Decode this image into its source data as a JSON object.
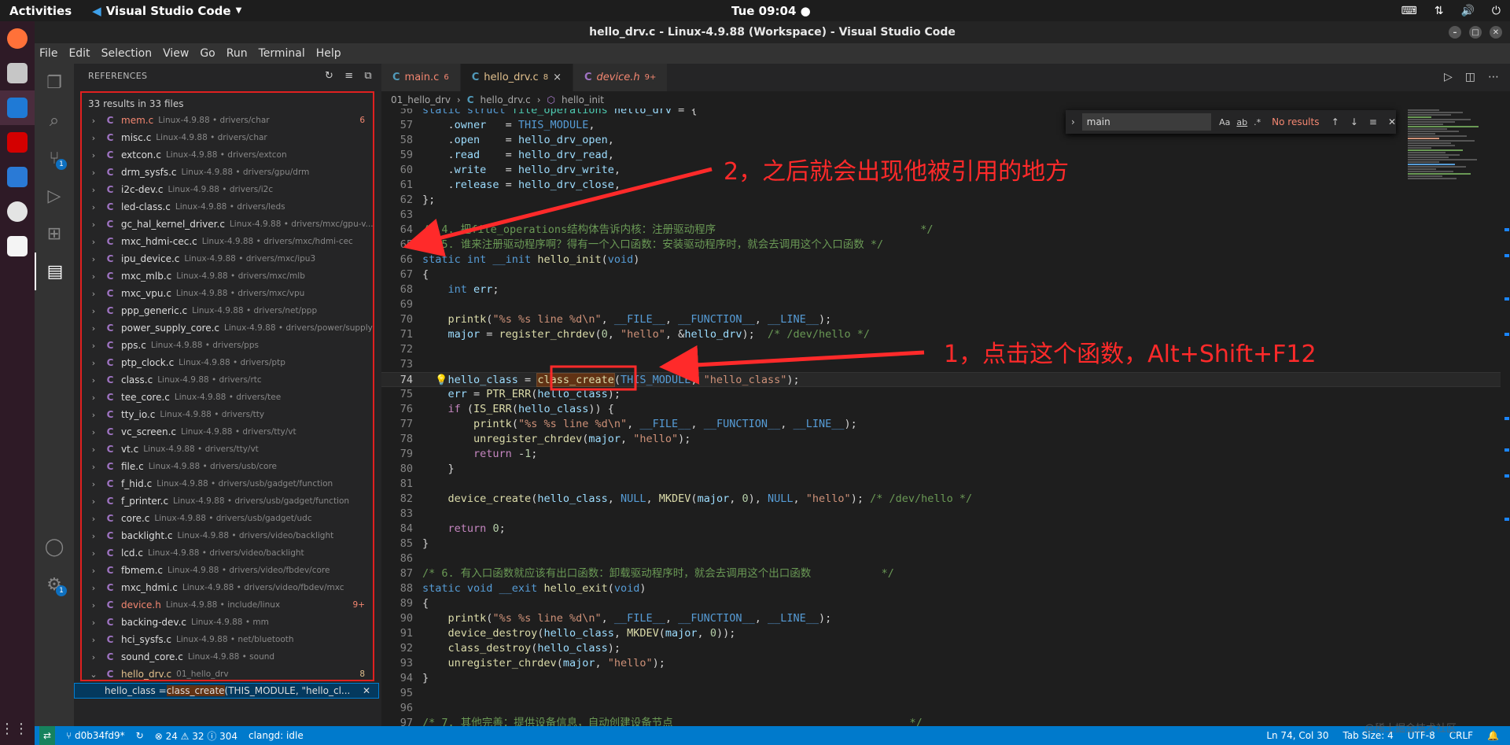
{
  "topbar": {
    "activities": "Activities",
    "app": "Visual Studio Code",
    "clock": "Tue 09:04"
  },
  "window_title": "hello_drv.c - Linux-4.9.88 (Workspace) - Visual Studio Code",
  "menu": [
    "File",
    "Edit",
    "Selection",
    "View",
    "Go",
    "Run",
    "Terminal",
    "Help"
  ],
  "activity_badges": {
    "scm": "1",
    "settings": "1"
  },
  "references": {
    "header": "REFERENCES",
    "summary": "33 results in 33 files",
    "items": [
      {
        "name": "mem.c",
        "path": "Linux-4.9.88 • drivers/char",
        "count": "6",
        "state": "err"
      },
      {
        "name": "misc.c",
        "path": "Linux-4.9.88 • drivers/char",
        "count": "",
        "state": ""
      },
      {
        "name": "extcon.c",
        "path": "Linux-4.9.88 • drivers/extcon",
        "count": "",
        "state": ""
      },
      {
        "name": "drm_sysfs.c",
        "path": "Linux-4.9.88 • drivers/gpu/drm",
        "count": "",
        "state": ""
      },
      {
        "name": "i2c-dev.c",
        "path": "Linux-4.9.88 • drivers/i2c",
        "count": "",
        "state": ""
      },
      {
        "name": "led-class.c",
        "path": "Linux-4.9.88 • drivers/leds",
        "count": "",
        "state": ""
      },
      {
        "name": "gc_hal_kernel_driver.c",
        "path": "Linux-4.9.88 • drivers/mxc/gpu-v...",
        "count": "",
        "state": ""
      },
      {
        "name": "mxc_hdmi-cec.c",
        "path": "Linux-4.9.88 • drivers/mxc/hdmi-cec",
        "count": "",
        "state": ""
      },
      {
        "name": "ipu_device.c",
        "path": "Linux-4.9.88 • drivers/mxc/ipu3",
        "count": "",
        "state": ""
      },
      {
        "name": "mxc_mlb.c",
        "path": "Linux-4.9.88 • drivers/mxc/mlb",
        "count": "",
        "state": ""
      },
      {
        "name": "mxc_vpu.c",
        "path": "Linux-4.9.88 • drivers/mxc/vpu",
        "count": "",
        "state": ""
      },
      {
        "name": "ppp_generic.c",
        "path": "Linux-4.9.88 • drivers/net/ppp",
        "count": "",
        "state": ""
      },
      {
        "name": "power_supply_core.c",
        "path": "Linux-4.9.88 • drivers/power/supply",
        "count": "",
        "state": ""
      },
      {
        "name": "pps.c",
        "path": "Linux-4.9.88 • drivers/pps",
        "count": "",
        "state": ""
      },
      {
        "name": "ptp_clock.c",
        "path": "Linux-4.9.88 • drivers/ptp",
        "count": "",
        "state": ""
      },
      {
        "name": "class.c",
        "path": "Linux-4.9.88 • drivers/rtc",
        "count": "",
        "state": ""
      },
      {
        "name": "tee_core.c",
        "path": "Linux-4.9.88 • drivers/tee",
        "count": "",
        "state": ""
      },
      {
        "name": "tty_io.c",
        "path": "Linux-4.9.88 • drivers/tty",
        "count": "",
        "state": ""
      },
      {
        "name": "vc_screen.c",
        "path": "Linux-4.9.88 • drivers/tty/vt",
        "count": "",
        "state": ""
      },
      {
        "name": "vt.c",
        "path": "Linux-4.9.88 • drivers/tty/vt",
        "count": "",
        "state": ""
      },
      {
        "name": "file.c",
        "path": "Linux-4.9.88 • drivers/usb/core",
        "count": "",
        "state": ""
      },
      {
        "name": "f_hid.c",
        "path": "Linux-4.9.88 • drivers/usb/gadget/function",
        "count": "",
        "state": ""
      },
      {
        "name": "f_printer.c",
        "path": "Linux-4.9.88 • drivers/usb/gadget/function",
        "count": "",
        "state": ""
      },
      {
        "name": "core.c",
        "path": "Linux-4.9.88 • drivers/usb/gadget/udc",
        "count": "",
        "state": ""
      },
      {
        "name": "backlight.c",
        "path": "Linux-4.9.88 • drivers/video/backlight",
        "count": "",
        "state": ""
      },
      {
        "name": "lcd.c",
        "path": "Linux-4.9.88 • drivers/video/backlight",
        "count": "",
        "state": ""
      },
      {
        "name": "fbmem.c",
        "path": "Linux-4.9.88 • drivers/video/fbdev/core",
        "count": "",
        "state": ""
      },
      {
        "name": "mxc_hdmi.c",
        "path": "Linux-4.9.88 • drivers/video/fbdev/mxc",
        "count": "",
        "state": ""
      },
      {
        "name": "device.h",
        "path": "Linux-4.9.88 • include/linux",
        "count": "9+",
        "state": "err"
      },
      {
        "name": "backing-dev.c",
        "path": "Linux-4.9.88 • mm",
        "count": "",
        "state": ""
      },
      {
        "name": "hci_sysfs.c",
        "path": "Linux-4.9.88 • net/bluetooth",
        "count": "",
        "state": ""
      },
      {
        "name": "sound_core.c",
        "path": "Linux-4.9.88 • sound",
        "count": "",
        "state": ""
      },
      {
        "name": "hello_drv.c",
        "path": "01_hello_drv",
        "count": "8",
        "state": "mod",
        "open": true
      }
    ],
    "selected_before": "hello_class = ",
    "selected_match": "class_create",
    "selected_after": "(THIS_MODULE, \"hello_cl...",
    "close": "✕"
  },
  "tabs": [
    {
      "icon": "C",
      "name": "main.c",
      "badge": "6",
      "state": "err"
    },
    {
      "icon": "C",
      "name": "hello_drv.c",
      "badge": "8",
      "state": "mod",
      "close": "×"
    },
    {
      "icon": "C",
      "name": "device.h",
      "badge": "9+",
      "state": "err"
    }
  ],
  "breadcrumb": {
    "folder": "01_hello_drv",
    "file": "hello_drv.c",
    "symbol": "hello_init"
  },
  "find": {
    "value": "main",
    "result": "No results",
    "case": "Aa",
    "word": "ab",
    "regex": ".*"
  },
  "status": {
    "branch": "d0b34fd9*",
    "problems": "⊗ 24 ⚠ 32 ⓘ 304",
    "clangd": "clangd: idle",
    "position": "Ln 74, Col 30",
    "tab_size": "Tab Size: 4",
    "encoding": "UTF-8",
    "eol": "CRLF"
  },
  "annotations": {
    "step2": "2，之后就会出现他被引用的地方",
    "step1": "1，点击这个函数，Alt+Shift+F12"
  },
  "watermark": "@稀土掘金技术社区",
  "colors": {
    "accent": "#007acc",
    "annotation_red": "#ff2a2a",
    "error": "#f48771",
    "modified": "#e2c08d"
  }
}
